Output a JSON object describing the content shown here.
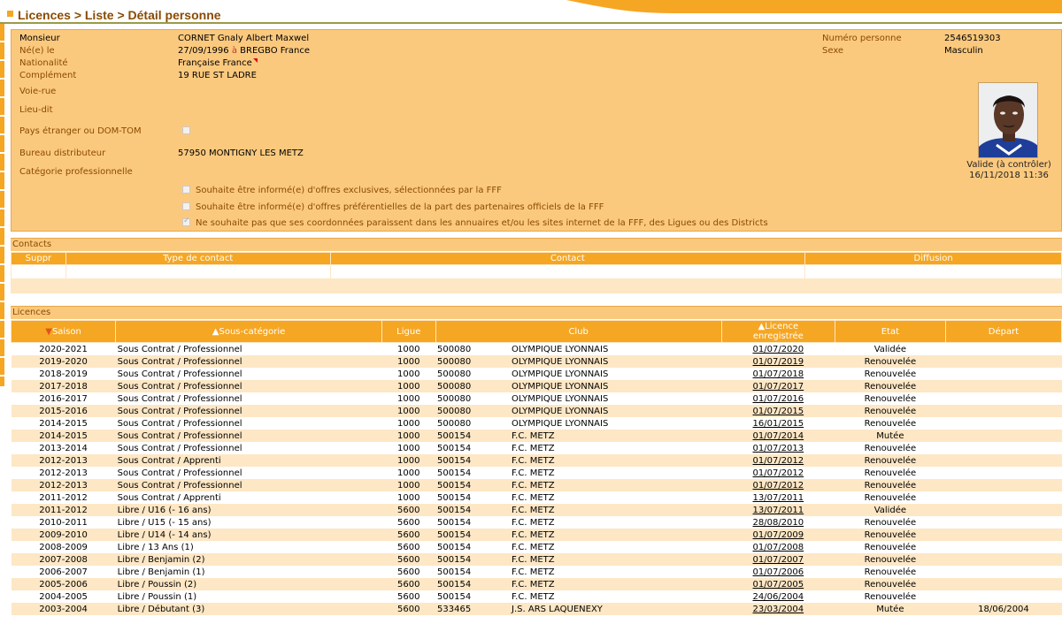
{
  "breadcrumb": "Licences > Liste > Détail personne",
  "person": {
    "civility": "Monsieur",
    "name": "CORNET Gnaly Albert Maxwel",
    "born_label": "Né(e) le",
    "born_date": "27/09/1996",
    "born_at": "à",
    "born_place": "BREGBO France",
    "nationality_label": "Nationalité",
    "nationality": "Française France",
    "complement_label": "Complément",
    "complement": "19 RUE ST LADRE",
    "street_label": "Voie-rue",
    "locality_label": "Lieu-dit",
    "foreign_label": "Pays étranger ou DOM-TOM",
    "office_label": "Bureau distributeur",
    "office": "57950 MONTIGNY LES METZ",
    "profession_label": "Catégorie professionnelle",
    "number_label": "Numéro personne",
    "number": "2546519303",
    "sex_label": "Sexe",
    "sex": "Masculin",
    "photo_status": "Valide (à contrôler)",
    "photo_date": "16/11/2018 11:36"
  },
  "options": [
    {
      "label": "Souhaite être informé(e) d'offres exclusives, sélectionnées par la FFF",
      "checked": false
    },
    {
      "label": "Souhaite être informé(e) d'offres préférentielles de la part des partenaires officiels de la FFF",
      "checked": false
    },
    {
      "label": "Ne souhaite pas que ses coordonnées paraissent dans les annuaires et/ou les sites internet de la FFF, des Ligues ou des Districts",
      "checked": true
    }
  ],
  "contacts": {
    "title": "Contacts",
    "headers": [
      "Suppr",
      "Type de contact",
      "Contact",
      "Diffusion"
    ]
  },
  "licences": {
    "title": "Licences",
    "headers": {
      "saison": "Saison",
      "sous_categorie": "Sous-catégorie",
      "ligue": "Ligue",
      "club": "Club",
      "licence_l1": "Licence",
      "licence_l2": "enregistrée",
      "etat": "Etat",
      "depart": "Départ"
    },
    "rows": [
      [
        "2020-2021",
        "Sous Contrat / Professionnel",
        "1000",
        "500080",
        "OLYMPIQUE LYONNAIS",
        "01/07/2020",
        "Validée",
        ""
      ],
      [
        "2019-2020",
        "Sous Contrat / Professionnel",
        "1000",
        "500080",
        "OLYMPIQUE LYONNAIS",
        "01/07/2019",
        "Renouvelée",
        ""
      ],
      [
        "2018-2019",
        "Sous Contrat / Professionnel",
        "1000",
        "500080",
        "OLYMPIQUE LYONNAIS",
        "01/07/2018",
        "Renouvelée",
        ""
      ],
      [
        "2017-2018",
        "Sous Contrat / Professionnel",
        "1000",
        "500080",
        "OLYMPIQUE LYONNAIS",
        "01/07/2017",
        "Renouvelée",
        ""
      ],
      [
        "2016-2017",
        "Sous Contrat / Professionnel",
        "1000",
        "500080",
        "OLYMPIQUE LYONNAIS",
        "01/07/2016",
        "Renouvelée",
        ""
      ],
      [
        "2015-2016",
        "Sous Contrat / Professionnel",
        "1000",
        "500080",
        "OLYMPIQUE LYONNAIS",
        "01/07/2015",
        "Renouvelée",
        ""
      ],
      [
        "2014-2015",
        "Sous Contrat / Professionnel",
        "1000",
        "500080",
        "OLYMPIQUE LYONNAIS",
        "16/01/2015",
        "Renouvelée",
        ""
      ],
      [
        "2014-2015",
        "Sous Contrat / Professionnel",
        "1000",
        "500154",
        "F.C. METZ",
        "01/07/2014",
        "Mutée",
        ""
      ],
      [
        "2013-2014",
        "Sous Contrat / Professionnel",
        "1000",
        "500154",
        "F.C. METZ",
        "01/07/2013",
        "Renouvelée",
        ""
      ],
      [
        "2012-2013",
        "Sous Contrat / Apprenti",
        "1000",
        "500154",
        "F.C. METZ",
        "01/07/2012",
        "Renouvelée",
        ""
      ],
      [
        "2012-2013",
        "Sous Contrat / Professionnel",
        "1000",
        "500154",
        "F.C. METZ",
        "01/07/2012",
        "Renouvelée",
        ""
      ],
      [
        "2012-2013",
        "Sous Contrat / Professionnel",
        "1000",
        "500154",
        "F.C. METZ",
        "01/07/2012",
        "Renouvelée",
        ""
      ],
      [
        "2011-2012",
        "Sous Contrat / Apprenti",
        "1000",
        "500154",
        "F.C. METZ",
        "13/07/2011",
        "Renouvelée",
        ""
      ],
      [
        "2011-2012",
        "Libre / U16 (- 16 ans)",
        "5600",
        "500154",
        "F.C. METZ",
        "13/07/2011",
        "Validée",
        ""
      ],
      [
        "2010-2011",
        "Libre / U15 (- 15 ans)",
        "5600",
        "500154",
        "F.C. METZ",
        "28/08/2010",
        "Renouvelée",
        ""
      ],
      [
        "2009-2010",
        "Libre / U14 (- 14 ans)",
        "5600",
        "500154",
        "F.C. METZ",
        "01/07/2009",
        "Renouvelée",
        ""
      ],
      [
        "2008-2009",
        "Libre / 13 Ans (1)",
        "5600",
        "500154",
        "F.C. METZ",
        "01/07/2008",
        "Renouvelée",
        ""
      ],
      [
        "2007-2008",
        "Libre / Benjamin (2)",
        "5600",
        "500154",
        "F.C. METZ",
        "01/07/2007",
        "Renouvelée",
        ""
      ],
      [
        "2006-2007",
        "Libre / Benjamin (1)",
        "5600",
        "500154",
        "F.C. METZ",
        "01/07/2006",
        "Renouvelée",
        ""
      ],
      [
        "2005-2006",
        "Libre / Poussin (2)",
        "5600",
        "500154",
        "F.C. METZ",
        "01/07/2005",
        "Renouvelée",
        ""
      ],
      [
        "2004-2005",
        "Libre / Poussin (1)",
        "5600",
        "500154",
        "F.C. METZ",
        "24/06/2004",
        "Renouvelée",
        ""
      ],
      [
        "2003-2004",
        "Libre / Débutant (3)",
        "5600",
        "533465",
        "J.S. ARS LAQUENEXY",
        "23/03/2004",
        "Mutée",
        "18/06/2004"
      ]
    ]
  },
  "colors": {
    "accent": "#f5a623",
    "panel": "#fbc97e",
    "label": "#8a4b00",
    "row_alt": "#fde7c5"
  },
  "icons": {
    "sort_desc": "down-arrow-icon",
    "sort_asc": "up-arrow-icon",
    "flag": "flag-icon"
  }
}
